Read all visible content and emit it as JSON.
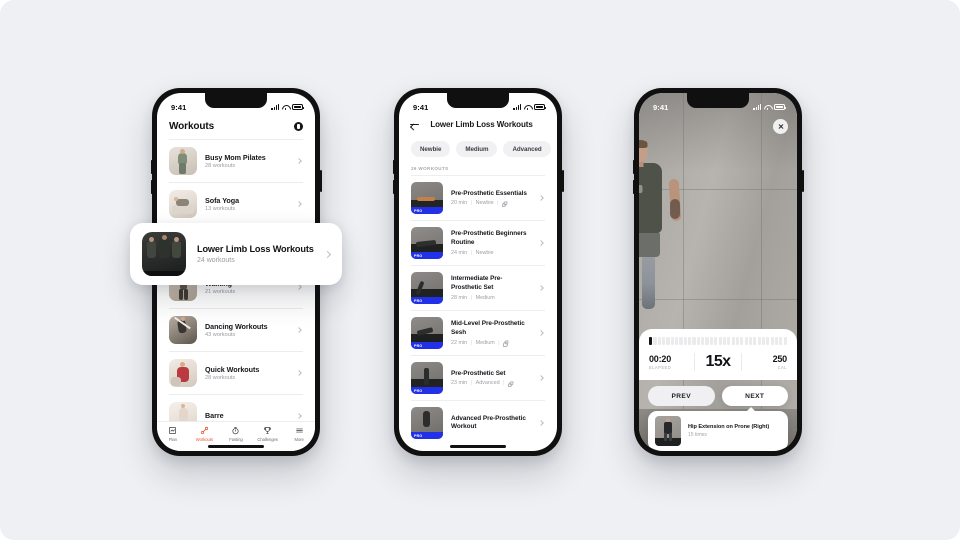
{
  "canvas": {
    "background": "#eef0f3"
  },
  "phone1": {
    "status": {
      "time": "9:41"
    },
    "nav": {
      "title": "Workouts",
      "info_icon": "info-circle-icon"
    },
    "list": [
      {
        "title": "Busy Mom Pilates",
        "sub": "28 workouts"
      },
      {
        "title": "Sofa Yoga",
        "sub": "13 workouts"
      },
      {
        "title": "Walking",
        "sub": "21 workouts"
      },
      {
        "title": "Dancing Workouts",
        "sub": "43 workouts"
      },
      {
        "title": "Quick Workouts",
        "sub": "28 workouts"
      },
      {
        "title": "Barre",
        "sub": ""
      }
    ],
    "featured": {
      "title": "Lower Limb Loss Workouts",
      "sub": "24 workouts"
    },
    "tabs": [
      {
        "label": "Plan",
        "icon": "plan-icon",
        "active": false
      },
      {
        "label": "Workouts",
        "icon": "workouts-icon",
        "active": true
      },
      {
        "label": "Fasting",
        "icon": "timer-icon",
        "active": false
      },
      {
        "label": "Challenges",
        "icon": "trophy-icon",
        "active": false
      },
      {
        "label": "More",
        "icon": "menu-icon",
        "active": false
      }
    ],
    "accent": "#f0542d"
  },
  "phone2": {
    "status": {
      "time": "9:41"
    },
    "nav": {
      "title": "Lower Limb Loss Workouts",
      "back_icon": "back-arrow-icon"
    },
    "filters": [
      "Newbie",
      "Medium",
      "Advanced"
    ],
    "count_label": "26 WORKOUTS",
    "pro_badge": "PRO",
    "workouts": [
      {
        "title": "Pre-Prosthetic Essentials",
        "duration": "20 min",
        "level": "Newbie",
        "equipment": true
      },
      {
        "title": "Pre-Prosthetic Beginners Routine",
        "duration": "24 min",
        "level": "Newbie",
        "equipment": false
      },
      {
        "title": "Intermediate Pre-Prosthetic Set",
        "duration": "28 min",
        "level": "Medium",
        "equipment": false
      },
      {
        "title": "Mid-Level Pre-Prosthetic Sesh",
        "duration": "22 min",
        "level": "Medium",
        "equipment": true
      },
      {
        "title": "Pre-Prosthetic Set",
        "duration": "23 min",
        "level": "Advanced",
        "equipment": true
      },
      {
        "title": "Advanced Pre-Prosthetic Workout",
        "duration": "",
        "level": "",
        "equipment": false
      }
    ],
    "pro_color": "#2230e8"
  },
  "phone3": {
    "status": {
      "time": "9:41"
    },
    "close_icon": "close-icon",
    "progress": {
      "total_segments": 32,
      "filled_segments": 1
    },
    "stats": {
      "elapsed_value": "00:20",
      "elapsed_label": "ELAPSED",
      "reps_value": "15x",
      "calories_value": "250",
      "calories_label": "CAL"
    },
    "buttons": {
      "prev": "PREV",
      "next": "NEXT"
    },
    "exercise": {
      "title": "Hip Extension on Prone (Right)",
      "sub": "15 times"
    }
  }
}
